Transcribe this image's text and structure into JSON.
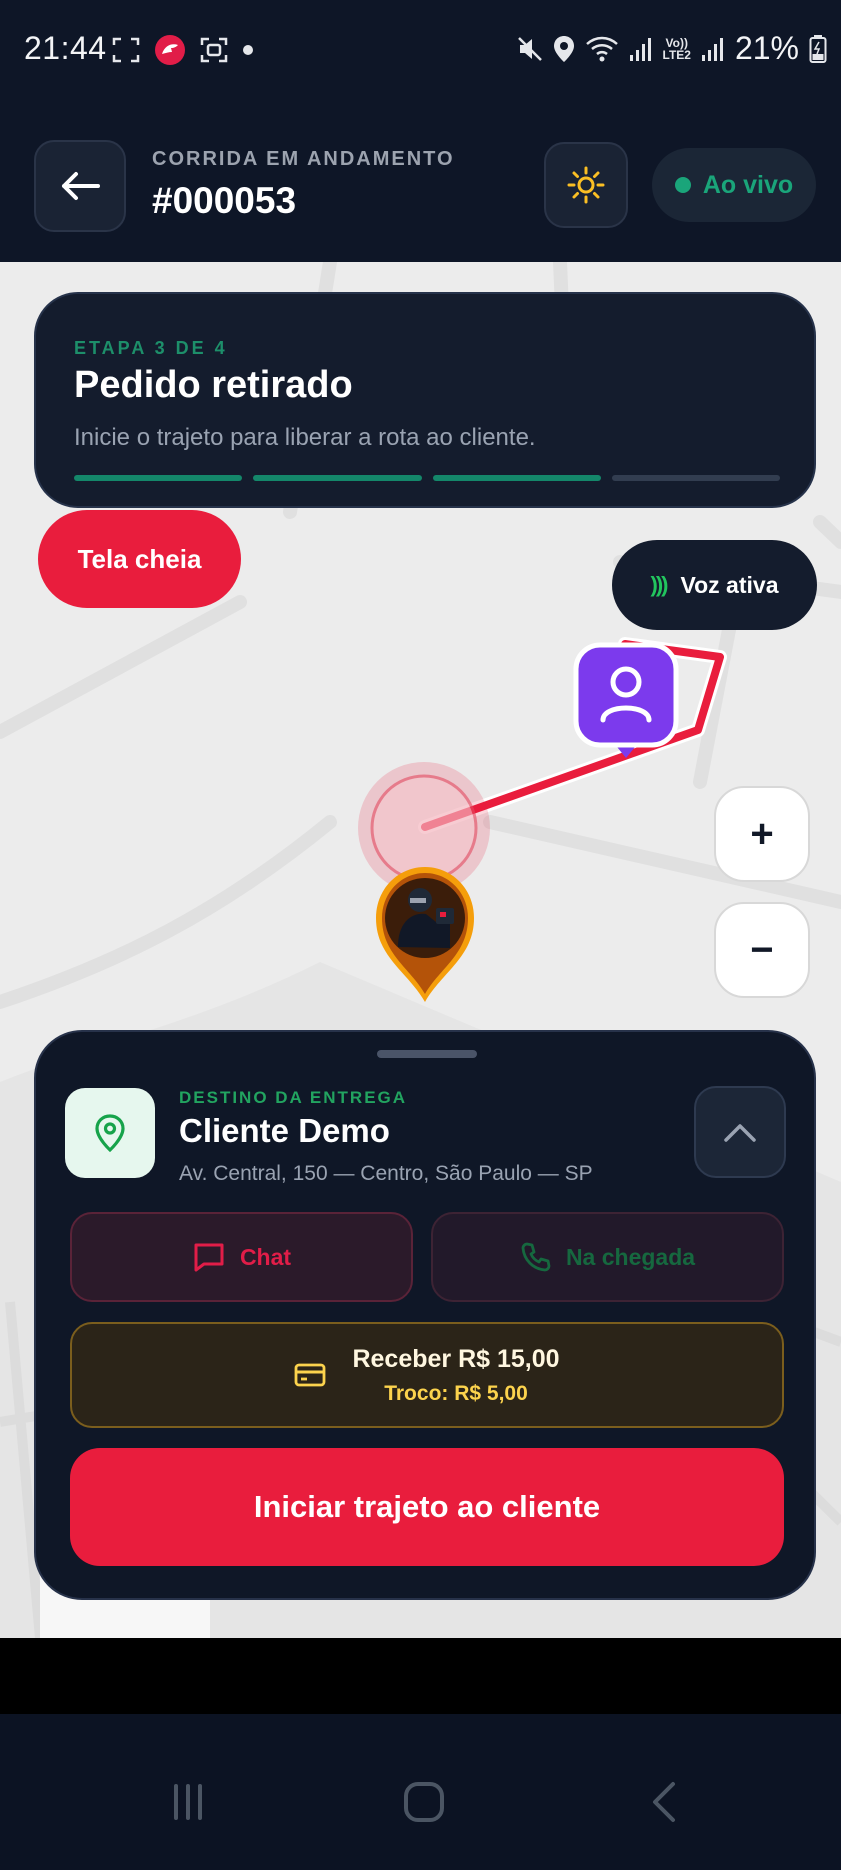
{
  "status_bar": {
    "time": "21:44",
    "battery_percent": "21%",
    "network_label_top": "Vo))",
    "network_label_bottom": "LTE2",
    "icons": [
      "screenshot-icon",
      "app-notification-icon",
      "scan-icon",
      "dot-icon",
      "mute-icon",
      "location-icon",
      "wifi-icon",
      "signal-icon",
      "signal-icon",
      "battery-icon"
    ]
  },
  "header": {
    "subtitle": "CORRIDA EM ANDAMENTO",
    "title": "#000053",
    "live_label": "Ao vivo",
    "colors": {
      "live": "#1aa57a",
      "theme_icon": "#fbbf24"
    }
  },
  "stage": {
    "label": "ETAPA 3 DE 4",
    "title": "Pedido retirado",
    "description": "Inicie o trajeto para liberar a rota ao cliente.",
    "progress": {
      "completed": 3,
      "total": 4
    }
  },
  "map": {
    "fullscreen_label": "Tela cheia",
    "voice_label": "Voz ativa",
    "voice_icon_glyph": ")))",
    "zoom_in_label": "+",
    "zoom_out_label": "−",
    "route_color": "#e91d3d",
    "client_marker_color": "#7c3aed"
  },
  "destination": {
    "label": "DESTINO DA ENTREGA",
    "name": "Cliente Demo",
    "address": "Av. Central, 150 — Centro, São Paulo — SP"
  },
  "actions": {
    "chat_label": "Chat",
    "call_label": "Na chegada",
    "payment_amount": "Receber R$ 15,00",
    "payment_change": "Troco: R$ 5,00",
    "start_label": "Iniciar trajeto ao cliente",
    "colors": {
      "primary": "#e91d3d",
      "payment_accent": "#fcd34d"
    }
  },
  "nav": {
    "icons": [
      "recent-apps-icon",
      "home-icon",
      "back-nav-icon"
    ]
  }
}
